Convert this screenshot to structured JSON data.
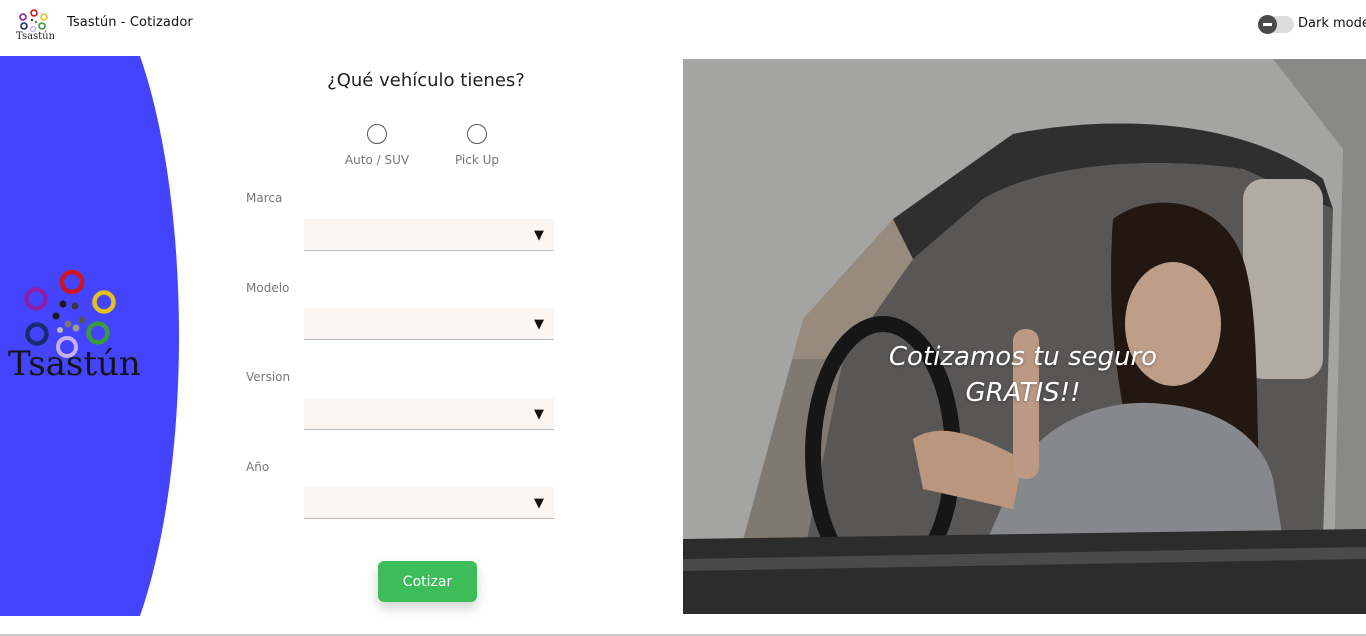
{
  "header": {
    "app_title": "Tsastún - Cotizador",
    "logo_icon": "tsastun-logo-icon",
    "dark_mode_label": "Dark mode",
    "dark_mode_on": false
  },
  "sidebar": {
    "brand_name": "Tsastún",
    "shape_color": "#4444ff"
  },
  "form": {
    "question": "¿Qué vehículo tienes?",
    "vehicle_types": [
      {
        "label": "Auto / SUV",
        "selected": false
      },
      {
        "label": "Pick Up",
        "selected": false
      }
    ],
    "fields": {
      "marca": {
        "label": "Marca",
        "value": ""
      },
      "modelo": {
        "label": "Modelo",
        "value": ""
      },
      "version": {
        "label": "Version",
        "value": ""
      },
      "anio": {
        "label": "Año",
        "value": ""
      }
    },
    "submit_label": "Cotizar",
    "submit_color": "#3dbc5a"
  },
  "hero": {
    "line1": "Cotizamos tu seguro",
    "line2": "GRATIS!!"
  }
}
